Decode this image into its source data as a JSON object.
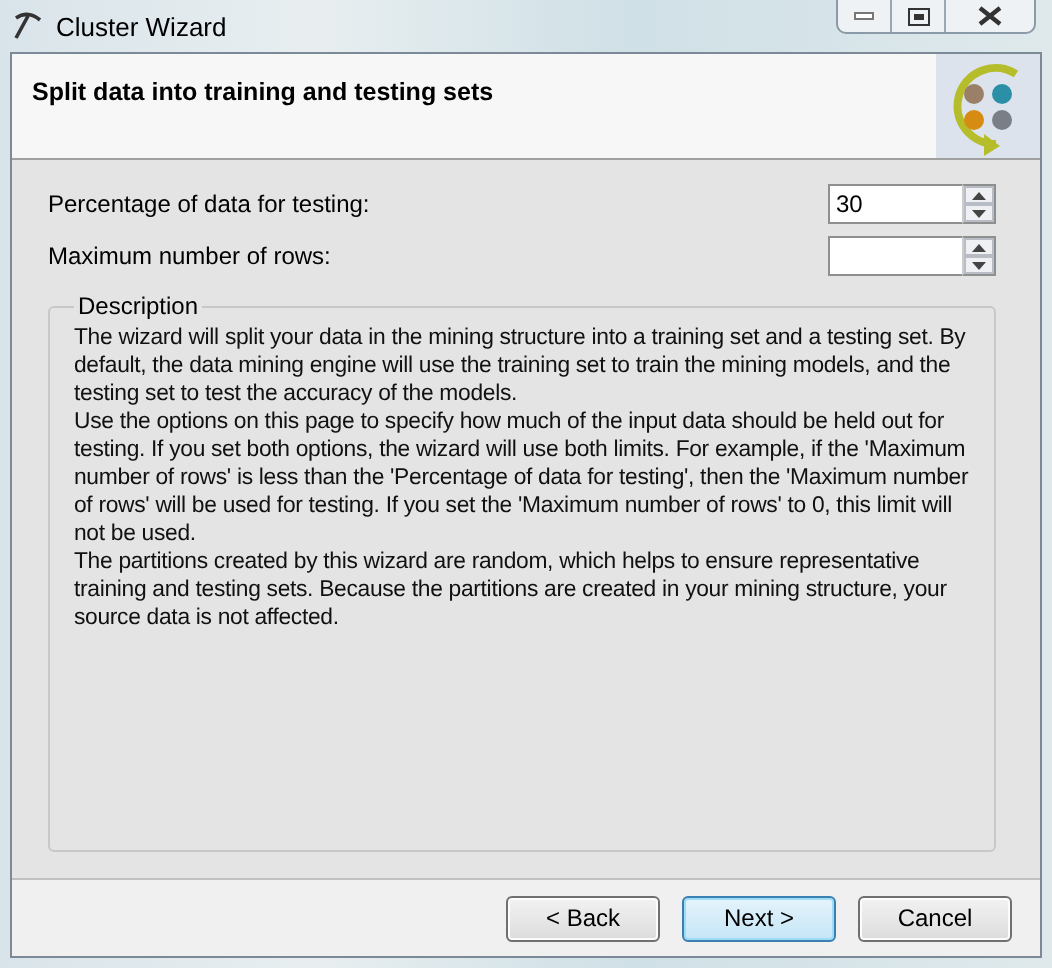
{
  "window": {
    "title": "Cluster Wizard"
  },
  "header": {
    "title": "Split data into training and testing sets"
  },
  "fields": [
    {
      "label": "Percentage of data for testing:",
      "value": "30"
    },
    {
      "label": "Maximum number of rows:"
    }
  ],
  "description": {
    "title": "Description",
    "paragraphs": [
      "The wizard will split your data in the mining structure into a training set and a testing set. By default, the data mining engine will use the training set to train the mining models, and the testing set to test the accuracy of the models.",
      "Use the options on this page to specify how much of the input data should be held out for testing. If you set both options, the wizard will use both limits. For example, if the 'Maximum number of rows' is less than the 'Percentage of data for testing', then the 'Maximum number of rows' will be used for testing. If you set the 'Maximum number of rows' to 0, this limit will not be used.",
      "The partitions created by this wizard are random, which helps to ensure representative training and testing sets. Because the partitions are created in your mining structure, your source data is not affected."
    ]
  },
  "buttons": [
    {
      "label": "< Back",
      "default": false
    },
    {
      "label": "Next >",
      "default": true
    },
    {
      "label": "Cancel",
      "default": false
    }
  ]
}
